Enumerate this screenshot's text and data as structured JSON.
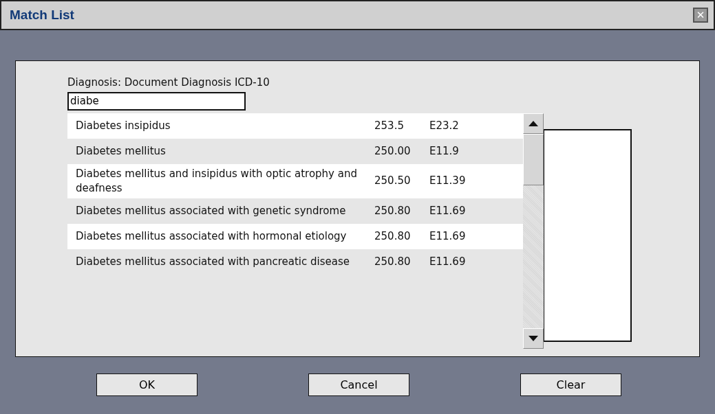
{
  "window": {
    "title": "Match List",
    "close": "✕"
  },
  "field": {
    "label": "Diagnosis: Document Diagnosis ICD-10",
    "value": "diabe"
  },
  "matches": [
    {
      "name": "Diabetes insipidus",
      "code_1": "253.5",
      "code_2": "E23.2"
    },
    {
      "name": "Diabetes mellitus",
      "code_1": "250.00",
      "code_2": "E11.9"
    },
    {
      "name": "Diabetes mellitus and insipidus with optic atrophy and deafness",
      "code_1": "250.50",
      "code_2": "E11.39"
    },
    {
      "name": "Diabetes mellitus associated with genetic syndrome",
      "code_1": "250.80",
      "code_2": "E11.69"
    },
    {
      "name": "Diabetes mellitus associated with hormonal etiology",
      "code_1": "250.80",
      "code_2": "E11.69"
    },
    {
      "name": "Diabetes mellitus associated with pancreatic disease",
      "code_1": "250.80",
      "code_2": "E11.69"
    }
  ],
  "buttons": [
    "OK",
    "Cancel",
    "Clear"
  ]
}
